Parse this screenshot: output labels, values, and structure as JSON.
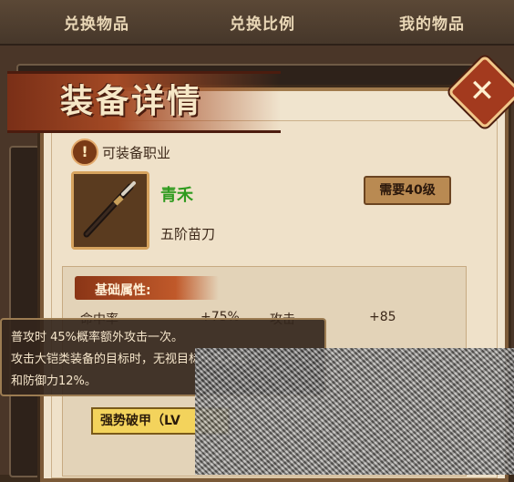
{
  "tabs": [
    {
      "label": "兑换物品"
    },
    {
      "label": "兑换比例"
    },
    {
      "label": "我的物品"
    }
  ],
  "modal": {
    "title": "装备详情",
    "close_icon": "crossed-swords-close"
  },
  "equipment": {
    "job_label": "可装备职业",
    "name": "青禾",
    "requirement": "需要40级",
    "type": "五阶苗刀",
    "icon": "blade-item-icon"
  },
  "stats": {
    "section_title": "基础属性:",
    "row1": {
      "left_label": "命中率",
      "left_value": "+75%",
      "right_label": "攻击",
      "right_value": "+85"
    }
  },
  "tooltip": {
    "line1": "普攻时 45%概率额外攻击一次。",
    "line2": "攻击大铠类装备的目标时，无视目标伤害减免",
    "line3": "和防御力12%。"
  },
  "skill": {
    "label": "强势破甲（LV"
  },
  "colors": {
    "item_name": "#2f9b1f",
    "banner": "#a44a25",
    "skill_button": "#f3d35c"
  }
}
